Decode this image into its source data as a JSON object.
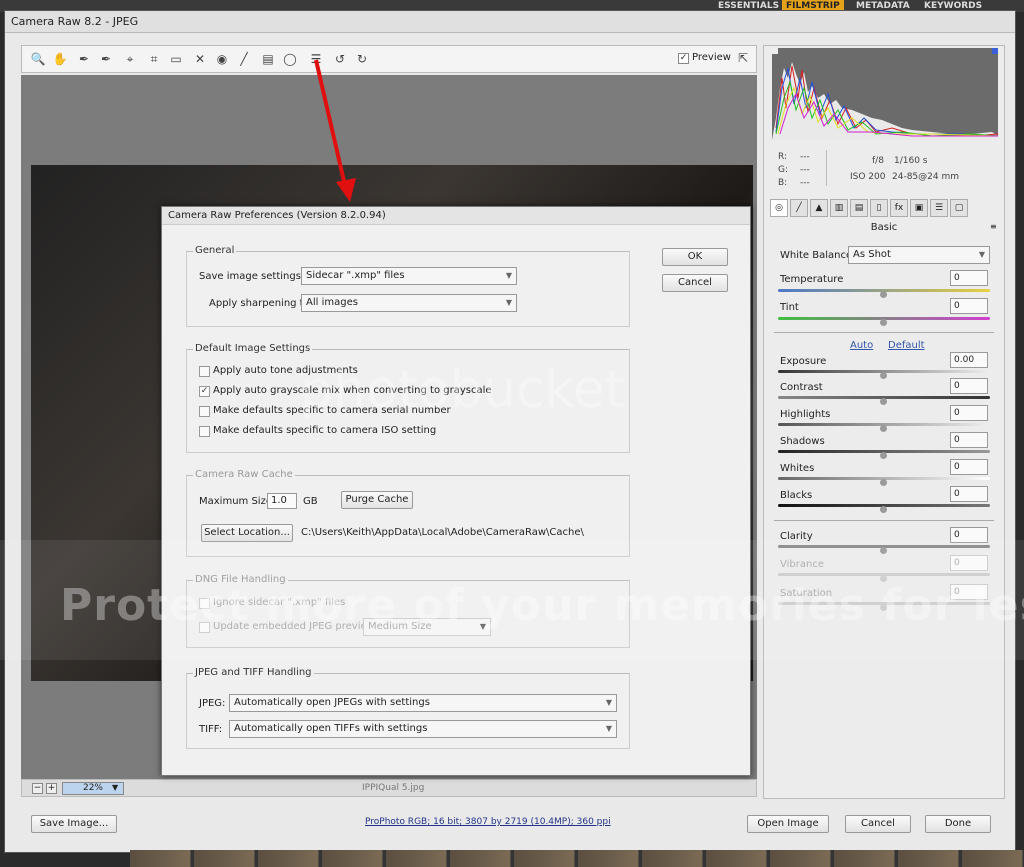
{
  "topbar": {
    "items": [
      "ESSENTIALS",
      "FILMSTRIP",
      "METADATA",
      "KEYWORDS"
    ],
    "active": "FILMSTRIP",
    "accent": "#e3a21a"
  },
  "window": {
    "title": "Camera Raw 8.2  -  JPEG"
  },
  "toolbar": {
    "tools": [
      "zoom-icon",
      "hand-icon",
      "white-balance-icon",
      "color-sampler-icon",
      "targeted-adjustment-icon",
      "crop-icon",
      "straighten-icon",
      "spot-removal-icon",
      "red-eye-icon",
      "adjustment-brush-icon",
      "graduated-filter-icon",
      "radial-filter-icon",
      "preferences-icon",
      "rotate-ccw-icon",
      "rotate-cw-icon"
    ],
    "preview_label": "Preview",
    "preview_checked": true
  },
  "status": {
    "zoom": "22%",
    "filename": "IPPIQual 5.jpg"
  },
  "exif": {
    "r": "R:",
    "g": "G:",
    "b": "B:",
    "r_val": "---",
    "g_val": "---",
    "b_val": "---",
    "aperture": "f/8",
    "shutter": "1/160 s",
    "iso": "ISO 200",
    "lens": "24-85@24 mm"
  },
  "panel": {
    "section": "Basic",
    "white_balance_label": "White Balance:",
    "white_balance_value": "As Shot",
    "temperature": {
      "label": "Temperature",
      "value": "0"
    },
    "tint": {
      "label": "Tint",
      "value": "0"
    },
    "auto_label": "Auto",
    "default_label": "Default",
    "exposure": {
      "label": "Exposure",
      "value": "0.00"
    },
    "contrast": {
      "label": "Contrast",
      "value": "0"
    },
    "highlights": {
      "label": "Highlights",
      "value": "0"
    },
    "shadows": {
      "label": "Shadows",
      "value": "0"
    },
    "whites": {
      "label": "Whites",
      "value": "0"
    },
    "blacks": {
      "label": "Blacks",
      "value": "0"
    },
    "clarity": {
      "label": "Clarity",
      "value": "0"
    },
    "vibrance": {
      "label": "Vibrance",
      "value": "0"
    },
    "saturation": {
      "label": "Saturation",
      "value": "0"
    }
  },
  "dialog": {
    "title": "Camera Raw Preferences  (Version 8.2.0.94)",
    "ok": "OK",
    "cancel": "Cancel",
    "general": {
      "title": "General",
      "save_label": "Save image settings in:",
      "save_value": "Sidecar \".xmp\" files",
      "sharpen_label": "Apply sharpening to:",
      "sharpen_value": "All images"
    },
    "defaults": {
      "title": "Default Image Settings",
      "auto_tone": "Apply auto tone adjustments",
      "auto_gray": "Apply auto grayscale mix when converting to grayscale",
      "serial": "Make defaults specific to camera serial number",
      "iso": "Make defaults specific to camera ISO setting"
    },
    "cache": {
      "title": "Camera Raw Cache",
      "max_label": "Maximum Size:",
      "max_value": "1.0",
      "unit": "GB",
      "purge": "Purge Cache",
      "select": "Select Location...",
      "path": "C:\\Users\\Keith\\AppData\\Local\\Adobe\\CameraRaw\\Cache\\"
    },
    "dng": {
      "title": "DNG File Handling",
      "ignore": "Ignore sidecar \".xmp\" files",
      "update": "Update embedded JPEG previews:",
      "update_value": "Medium Size"
    },
    "jpeg_tiff": {
      "title": "JPEG and TIFF Handling",
      "jpeg_label": "JPEG:",
      "jpeg_value": "Automatically open JPEGs with settings",
      "tiff_label": "TIFF:",
      "tiff_value": "Automatically open TIFFs with settings"
    }
  },
  "bottom": {
    "save": "Save Image...",
    "info": "ProPhoto RGB; 16 bit; 3807 by 2719 (10.4MP); 360 ppi",
    "open": "Open Image",
    "cancel": "Cancel",
    "done": "Done"
  },
  "watermark": {
    "text": "Protect more of your memories for less!",
    "logo": "photobucket"
  }
}
